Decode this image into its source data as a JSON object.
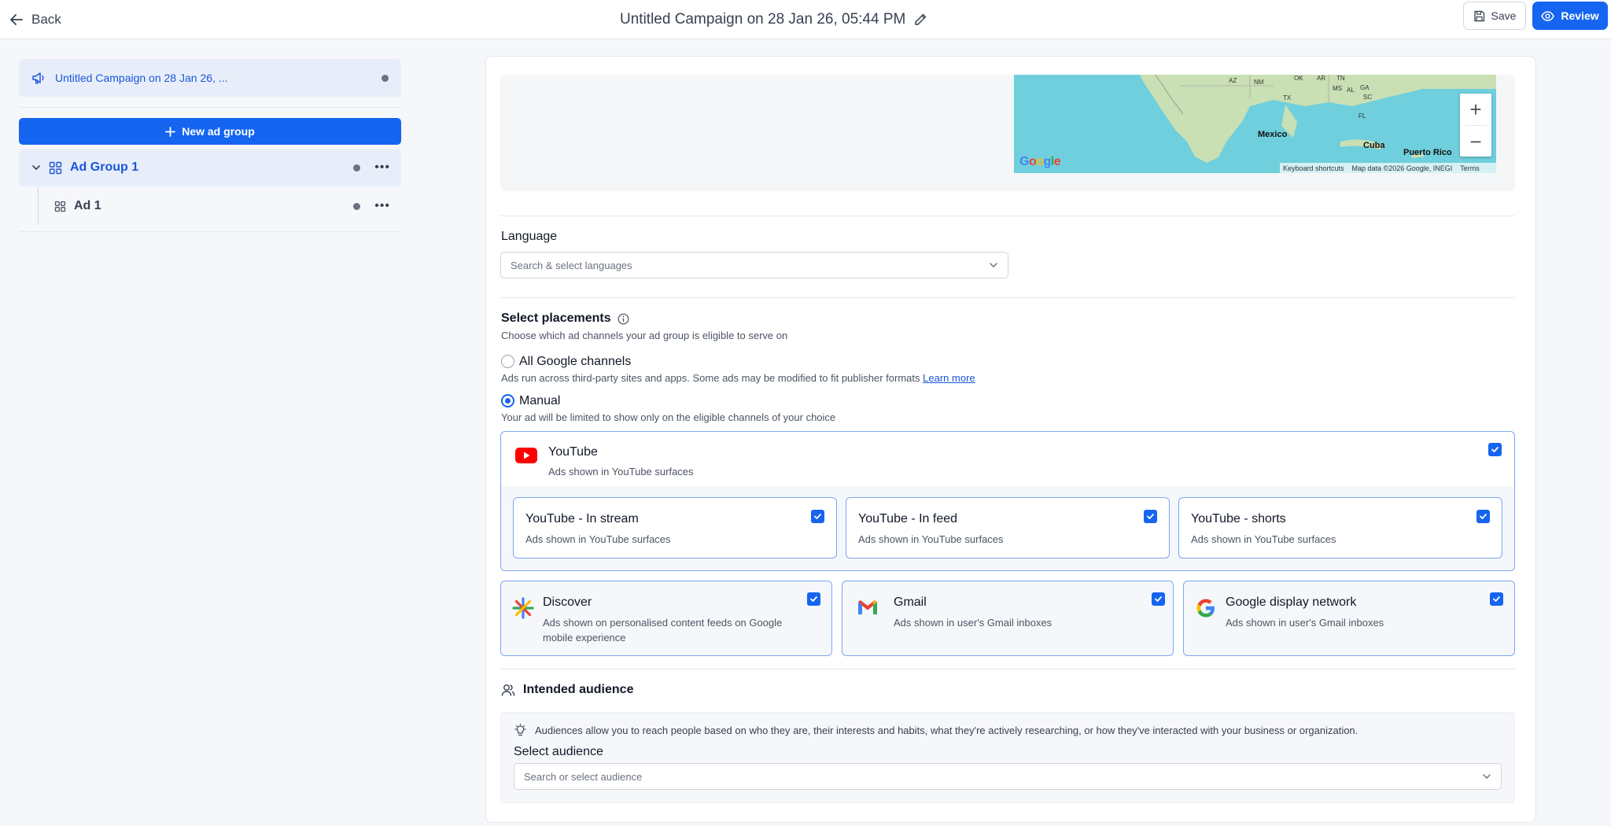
{
  "header": {
    "back_label": "Back",
    "campaign_title": "Untitled Campaign on 28 Jan 26, 05:44 PM",
    "save_label": "Save",
    "review_label": "Review"
  },
  "sidebar": {
    "campaign_label": "Untitled Campaign on 28 Jan 26, ...",
    "new_ad_group_label": "New ad group",
    "ad_group_label": "Ad Group 1",
    "ad_label": "Ad 1"
  },
  "map": {
    "labels": {
      "mexico": "Mexico",
      "cuba": "Cuba",
      "puerto_rico": "Puerto Rico",
      "az": "AZ",
      "nm": "NM",
      "tx": "TX",
      "ok": "OK",
      "ar": "AR",
      "ms": "MS",
      "al": "AL",
      "ga": "GA",
      "sc": "SC",
      "fl": "FL",
      "tn": "TN"
    },
    "google_logo": "Google",
    "keyboard_shortcuts": "Keyboard shortcuts",
    "map_data": "Map data ©2026 Google, INEGI",
    "terms": "Terms",
    "zoom_in": "+",
    "zoom_out": "−"
  },
  "language": {
    "title": "Language",
    "placeholder": "Search & select languages"
  },
  "placements": {
    "title": "Select placements",
    "subtitle": "Choose which ad channels your ad group is eligible to serve on",
    "option_all": {
      "label": "All Google channels",
      "desc": "Ads run across third-party sites and apps. Some ads may be modified to fit publisher formats",
      "learn_more": "Learn more",
      "selected": false
    },
    "option_manual": {
      "label": "Manual",
      "desc": "Your ad will be limited to show only on the eligible channels of your choice",
      "selected": true
    },
    "youtube": {
      "name": "YouTube",
      "desc": "Ads shown in YouTube surfaces",
      "checked": true,
      "sub": [
        {
          "name": "YouTube - In stream",
          "desc": "Ads shown in YouTube surfaces",
          "checked": true
        },
        {
          "name": "YouTube - In feed",
          "desc": "Ads shown in YouTube surfaces",
          "checked": true
        },
        {
          "name": "YouTube - shorts",
          "desc": "Ads shown in YouTube surfaces",
          "checked": true
        }
      ]
    },
    "channels": [
      {
        "name": "Discover",
        "desc": "Ads shown on personalised content feeds on Google mobile experience",
        "checked": true
      },
      {
        "name": "Gmail",
        "desc": "Ads shown in user's Gmail inboxes",
        "checked": true
      },
      {
        "name": "Google display network",
        "desc": "Ads shown in user's Gmail inboxes",
        "checked": true
      }
    ]
  },
  "audience": {
    "title": "Intended audience",
    "tip": "Audiences allow you to reach people based on who they are, their interests and habits, what they're actively researching, or how they've interacted with your business or organization.",
    "select_label": "Select audience",
    "placeholder": "Search or select audience"
  },
  "colors": {
    "primary": "#1565f0",
    "selected_bg": "#e8eef9",
    "card_border": "#7ea6ee",
    "map_water": "#6fcfdc"
  }
}
